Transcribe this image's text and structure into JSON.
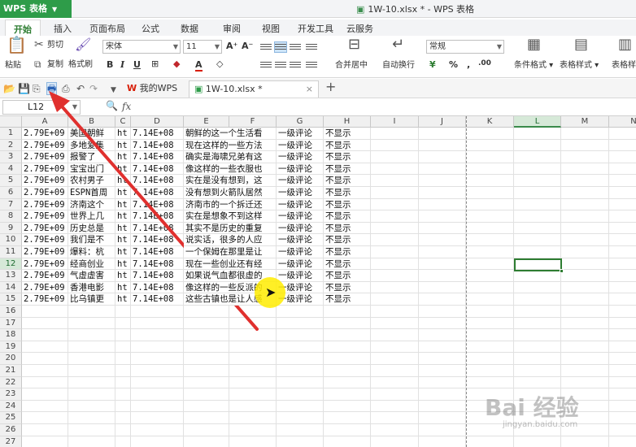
{
  "app": {
    "title": "WPS 表格",
    "window_title": "1W-10.xlsx * - WPS 表格"
  },
  "ribbon_tabs": [
    "开始",
    "插入",
    "页面布局",
    "公式",
    "数据",
    "审阅",
    "视图",
    "开发工具",
    "云服务"
  ],
  "ribbon": {
    "paste": "粘贴",
    "cut": "剪切",
    "copy": "复制",
    "format_painter": "格式刷",
    "font_name": "宋体",
    "font_size": "11",
    "merge_center": "合并居中",
    "wrap_text": "自动换行",
    "number_format": "常规",
    "conditional_format": "条件格式",
    "table_format": "表格样式",
    "table_tool": "表格样"
  },
  "doc_tabs": [
    {
      "label": "我的WPS",
      "icon": "wps-logo-icon"
    },
    {
      "label": "1W-10.xlsx *",
      "icon": "spreadsheet-file-icon"
    }
  ],
  "formula_bar": {
    "name_box": "L12",
    "fx_label": "fx",
    "formula": ""
  },
  "columns": [
    "A",
    "B",
    "C",
    "D",
    "E",
    "F",
    "G",
    "H",
    "I",
    "J",
    "K",
    "L",
    "M",
    "N"
  ],
  "row_numbers": [
    "1",
    "2",
    "3",
    "4",
    "5",
    "6",
    "7",
    "8",
    "9",
    "10",
    "11",
    "12",
    "13",
    "14",
    "15",
    "16",
    "17",
    "18",
    "19",
    "20",
    "21",
    "22",
    "23",
    "24",
    "25",
    "26",
    "27"
  ],
  "selected_cell": {
    "column": "L",
    "row": "12"
  },
  "rows": [
    [
      "2.79E+09",
      "美国朝鲜",
      "ht",
      "7.14E+08",
      "朝鲜的这一个生活看",
      "一级评论",
      "不显示"
    ],
    [
      "2.79E+09",
      "多地爱集",
      "ht",
      "7.14E+08",
      "现在这样的一些方法",
      "一级评论",
      "不显示"
    ],
    [
      "2.79E+09",
      "报警了",
      "ht",
      "7.14E+08",
      "确实是海啸兄弟有这",
      "一级评论",
      "不显示"
    ],
    [
      "2.79E+09",
      "宝宝出门",
      "ht",
      "7.14E+08",
      "像这样的一些衣服也",
      "一级评论",
      "不显示"
    ],
    [
      "2.79E+09",
      "农村男子",
      "ht",
      "7.14E+08",
      "实在是没有想到，这",
      "一级评论",
      "不显示"
    ],
    [
      "2.79E+09",
      "ESPN首周",
      "ht",
      "7.14E+08",
      "没有想到火箭队居然",
      "一级评论",
      "不显示"
    ],
    [
      "2.79E+09",
      "济南这个",
      "ht",
      "7.14E+08",
      "济南市的一个拆迁还",
      "一级评论",
      "不显示"
    ],
    [
      "2.79E+09",
      "世界上几",
      "ht",
      "7.14E+08",
      "实在是想象不到这样",
      "一级评论",
      "不显示"
    ],
    [
      "2.79E+09",
      "历史总是",
      "ht",
      "7.14E+08",
      "其实不是历史的重复",
      "一级评论",
      "不显示"
    ],
    [
      "2.79E+09",
      "我们是不",
      "ht",
      "7.14E+08",
      "说实话，很多的人应",
      "一级评论",
      "不显示"
    ],
    [
      "2.79E+09",
      "爆料：杭",
      "ht",
      "7.14E+08",
      "一个保姆在那里是让",
      "一级评论",
      "不显示"
    ],
    [
      "2.79E+09",
      "经商创业",
      "ht",
      "7.14E+08",
      "现在一些创业还有经",
      "一级评论",
      "不显示"
    ],
    [
      "2.79E+09",
      "气虚虚害",
      "ht",
      "7.14E+08",
      "如果说气血都很虚的",
      "一级评论",
      "不显示"
    ],
    [
      "2.79E+09",
      "香港电影",
      "ht",
      "7.14E+08",
      "像这样的一些反派的",
      "一级评论",
      "不显示"
    ],
    [
      "2.79E+09",
      "比乌镇更",
      "ht",
      "7.14E+08",
      "这些古镇也是让人感",
      "一级评论",
      "不显示"
    ]
  ],
  "watermark": {
    "main": "Bai 经验",
    "sub": "jingyan.baidu.com"
  },
  "annotation": {
    "arrow_color": "#e0302e",
    "highlight_color": "#ffec00"
  },
  "colors": {
    "brand_green": "#2e9c49",
    "selection_green": "#2e7d32"
  }
}
